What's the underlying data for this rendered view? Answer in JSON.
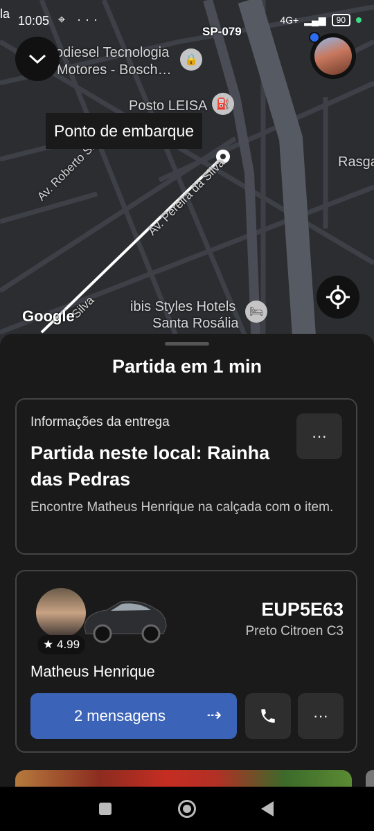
{
  "status_bar": {
    "left_fragment": "la",
    "time": "10:05",
    "extra_icons": "⌖ ···",
    "network": "4G+",
    "battery": "90",
    "highway_label": "SP-079"
  },
  "map": {
    "labels": {
      "poi1_line1": "odiesel Tecnologia",
      "poi1_line2": "Motores -  Bosch…",
      "poi2": "Posto LEISA",
      "poi3_line1": "ibis Styles Hotels",
      "poi3_line2": "Santa Rosália",
      "street1": "Av. Roberto Simonsen",
      "street2": "Av. Pereira da Silva",
      "street3": "Silva",
      "right_edge": "Rasga"
    },
    "tooltip": "Ponto de embarque",
    "google_logo": "Google"
  },
  "icons": {
    "collapse": "chevron-down-icon",
    "recenter": "crosshair-icon",
    "more": "more-icon",
    "phone": "phone-icon",
    "arrow": "arrow-right-icon",
    "star": "star-icon"
  },
  "sheet": {
    "title": "Partida em 1 min",
    "delivery": {
      "label": "Informações da entrega",
      "title": "Partida neste local: Rainha das Pedras",
      "description": "Encontre Matheus Henrique na calçada com o item.",
      "more_label": "···"
    },
    "driver": {
      "rating": "4.99",
      "plate": "EUP5E63",
      "car": "Preto Citroen C3",
      "name": "Matheus Henrique",
      "messages_button": "2 mensagens",
      "more_label": "···"
    }
  },
  "colors": {
    "accent_blue": "#3b63b8",
    "sheet_bg": "#1a1a1a",
    "map_bg": "#2b2d31"
  }
}
